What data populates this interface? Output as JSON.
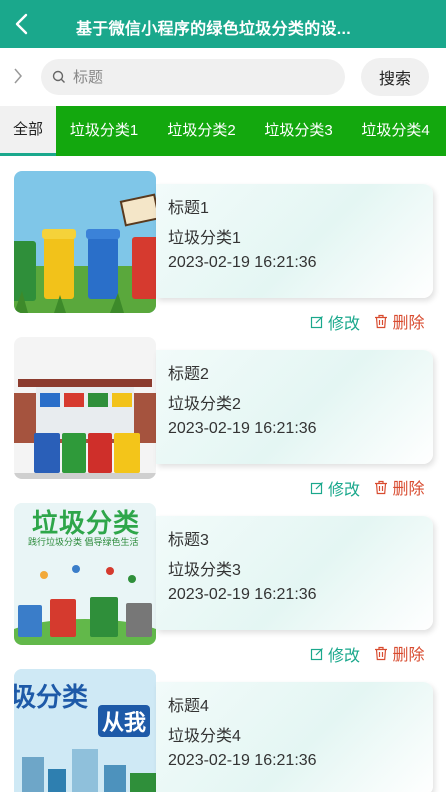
{
  "header": {
    "title": "基于微信小程序的绿色垃圾分类的设..."
  },
  "search": {
    "placeholder": "标题",
    "button_label": "搜索"
  },
  "tabs": [
    {
      "label": "全部",
      "active": true
    },
    {
      "label": "垃圾分类1",
      "active": false
    },
    {
      "label": "垃圾分类2",
      "active": false
    },
    {
      "label": "垃圾分类3",
      "active": false
    },
    {
      "label": "垃圾分类4",
      "active": false
    }
  ],
  "items": [
    {
      "title": "标题1",
      "category": "垃圾分类1",
      "time": "2023-02-19 16:21:36",
      "image_text": ""
    },
    {
      "title": "标题2",
      "category": "垃圾分类2",
      "time": "2023-02-19 16:21:36",
      "image_text": ""
    },
    {
      "title": "标题3",
      "category": "垃圾分类3",
      "time": "2023-02-19 16:21:36",
      "image_text": "垃圾分类",
      "image_subtext": "践行垃圾分类 倡导绿色生活"
    },
    {
      "title": "标题4",
      "category": "垃圾分类4",
      "time": "2023-02-19 16:21:36",
      "image_text": "圾分类",
      "image_text2": "从我"
    }
  ],
  "actions": {
    "edit_label": "修改",
    "delete_label": "删除"
  },
  "colors": {
    "header": "#1aa88c",
    "tabs": "#13a80e",
    "edit": "#1aa88c",
    "delete": "#d84b2f"
  }
}
